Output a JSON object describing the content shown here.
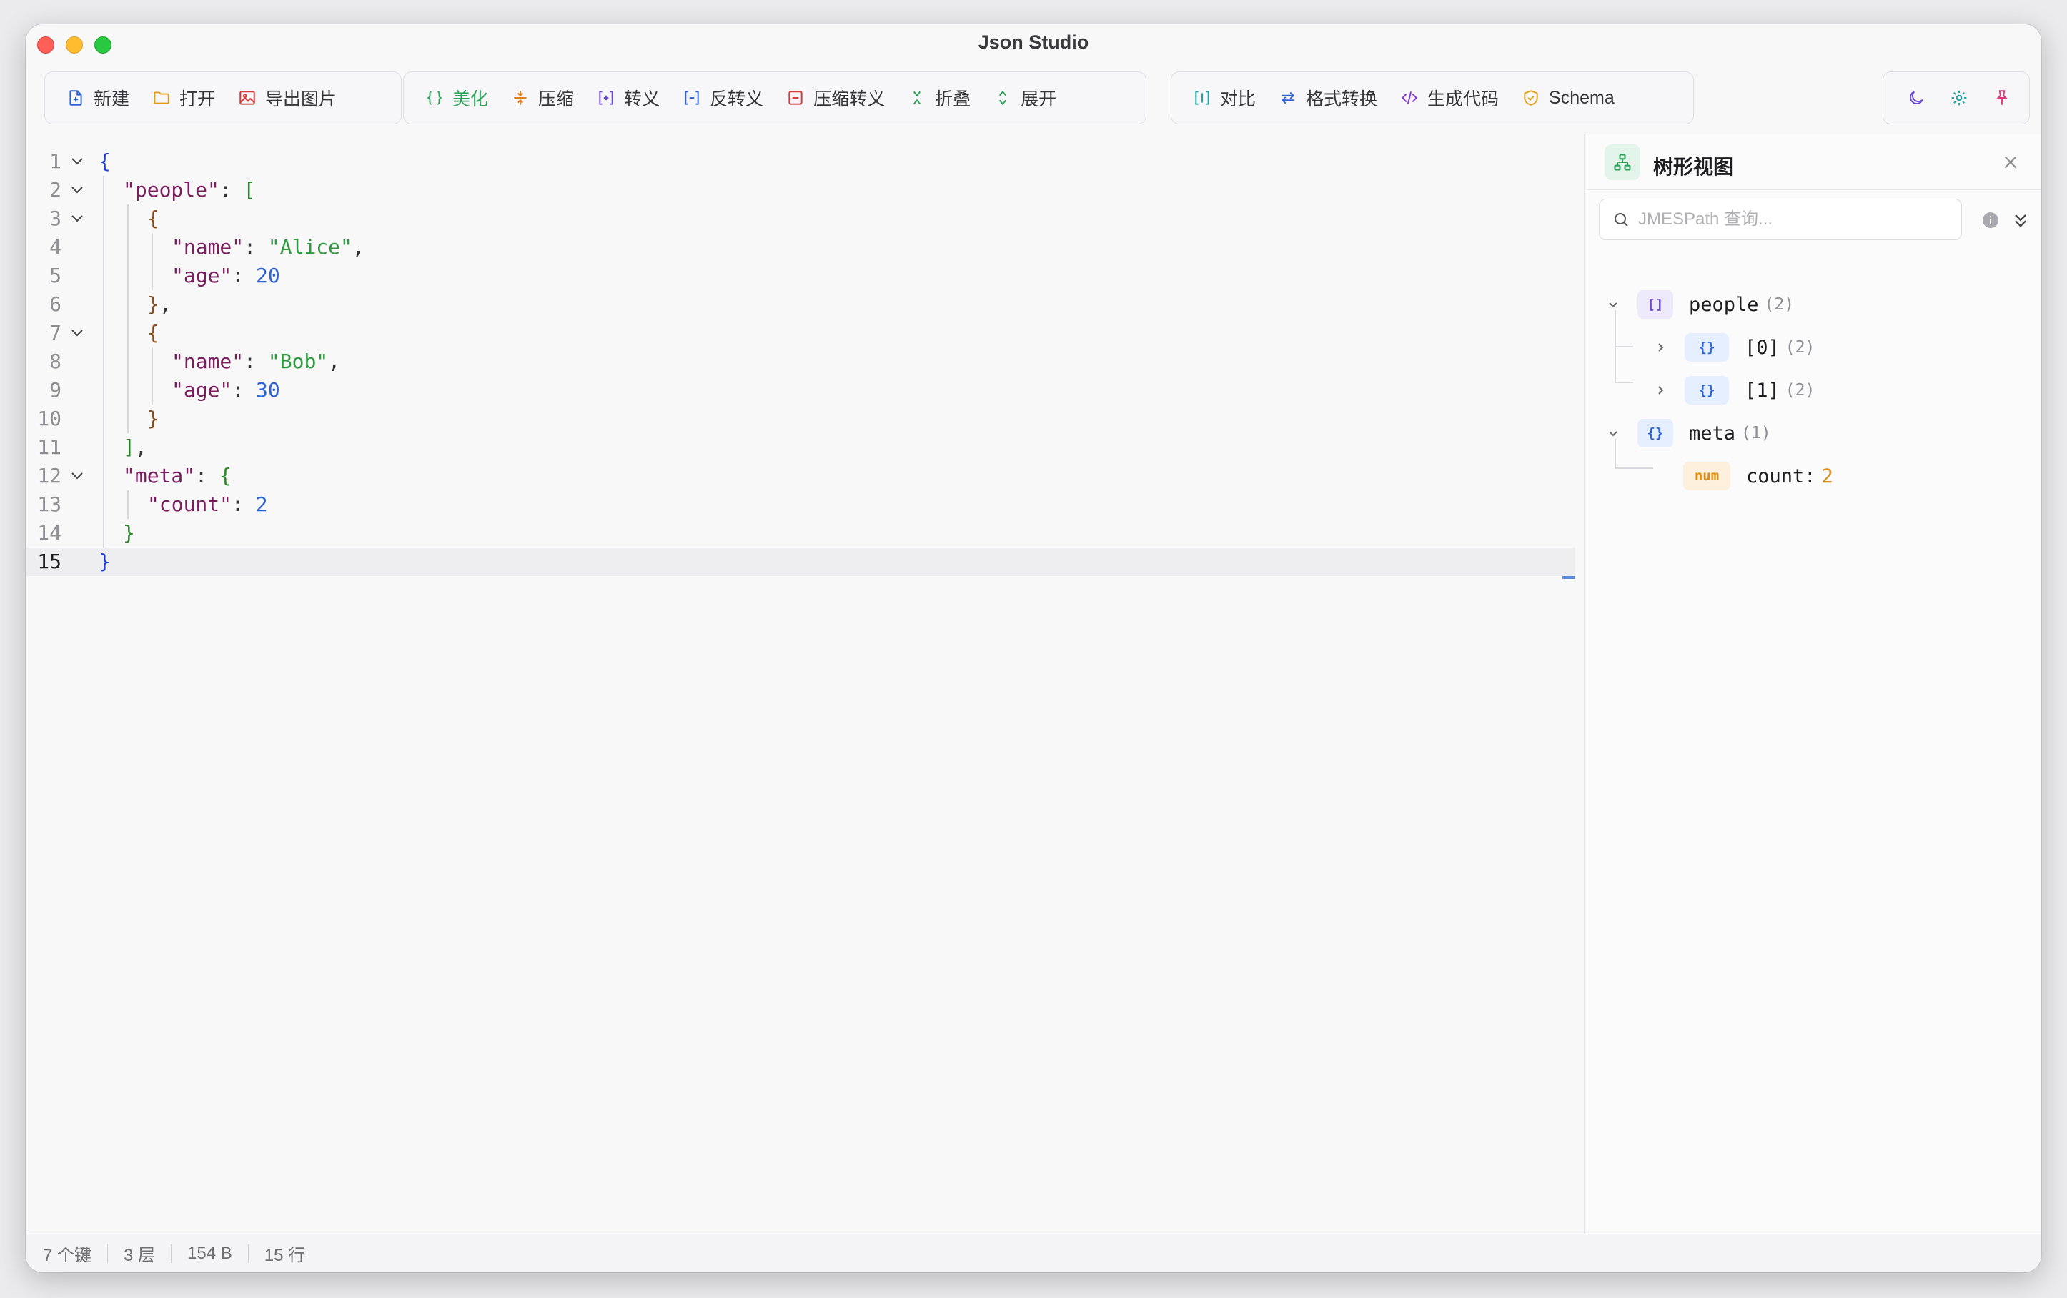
{
  "window": {
    "title": "Json Studio"
  },
  "toolbar": {
    "file_group": [
      {
        "name": "new-button",
        "icon": "new-file-icon",
        "label": "新建"
      },
      {
        "name": "open-button",
        "icon": "folder-icon",
        "label": "打开"
      },
      {
        "name": "export-image-button",
        "icon": "image-icon",
        "label": "导出图片"
      }
    ],
    "format_group": [
      {
        "name": "beautify-button",
        "icon": "braces-icon",
        "label": "美化"
      },
      {
        "name": "compress-button",
        "icon": "compress-icon",
        "label": "压缩"
      },
      {
        "name": "escape-button",
        "icon": "escape-icon",
        "label": "转义"
      },
      {
        "name": "unescape-button",
        "icon": "unescape-icon",
        "label": "反转义"
      },
      {
        "name": "compress-escape-button",
        "icon": "minus-box-icon",
        "label": "压缩转义"
      },
      {
        "name": "collapse-button",
        "icon": "collapse-icon",
        "label": "折叠"
      },
      {
        "name": "expand-button",
        "icon": "expand-icon",
        "label": "展开"
      }
    ],
    "tools_group": [
      {
        "name": "compare-button",
        "icon": "compare-icon",
        "label": "对比"
      },
      {
        "name": "format-convert-button",
        "icon": "arrows-icon",
        "label": "格式转换"
      },
      {
        "name": "generate-code-button",
        "icon": "code-icon",
        "label": "生成代码"
      },
      {
        "name": "schema-button",
        "icon": "shield-icon",
        "label": "Schema"
      }
    ],
    "right_icons": [
      {
        "name": "dark-mode-icon"
      },
      {
        "name": "settings-gear-icon"
      },
      {
        "name": "pin-icon"
      }
    ]
  },
  "editor": {
    "current_line": 15,
    "lines": [
      {
        "num": "1",
        "fold": true,
        "indent": 0,
        "tokens": [
          [
            "b0",
            "{"
          ]
        ]
      },
      {
        "num": "2",
        "fold": true,
        "indent": 1,
        "tokens": [
          [
            "k",
            "\"people\""
          ],
          [
            "p",
            ": "
          ],
          [
            "b1",
            "["
          ]
        ]
      },
      {
        "num": "3",
        "fold": true,
        "indent": 2,
        "tokens": [
          [
            "b2",
            "{"
          ]
        ]
      },
      {
        "num": "4",
        "fold": false,
        "indent": 3,
        "tokens": [
          [
            "k",
            "\"name\""
          ],
          [
            "p",
            ": "
          ],
          [
            "s",
            "\"Alice\""
          ],
          [
            "p",
            ","
          ]
        ]
      },
      {
        "num": "5",
        "fold": false,
        "indent": 3,
        "tokens": [
          [
            "k",
            "\"age\""
          ],
          [
            "p",
            ": "
          ],
          [
            "n",
            "20"
          ]
        ]
      },
      {
        "num": "6",
        "fold": false,
        "indent": 2,
        "tokens": [
          [
            "b2",
            "}"
          ],
          [
            "p",
            ","
          ]
        ]
      },
      {
        "num": "7",
        "fold": true,
        "indent": 2,
        "tokens": [
          [
            "b2",
            "{"
          ]
        ]
      },
      {
        "num": "8",
        "fold": false,
        "indent": 3,
        "tokens": [
          [
            "k",
            "\"name\""
          ],
          [
            "p",
            ": "
          ],
          [
            "s",
            "\"Bob\""
          ],
          [
            "p",
            ","
          ]
        ]
      },
      {
        "num": "9",
        "fold": false,
        "indent": 3,
        "tokens": [
          [
            "k",
            "\"age\""
          ],
          [
            "p",
            ": "
          ],
          [
            "n",
            "30"
          ]
        ]
      },
      {
        "num": "10",
        "fold": false,
        "indent": 2,
        "tokens": [
          [
            "b2",
            "}"
          ]
        ]
      },
      {
        "num": "11",
        "fold": false,
        "indent": 1,
        "tokens": [
          [
            "b1",
            "]"
          ],
          [
            "p",
            ","
          ]
        ]
      },
      {
        "num": "12",
        "fold": true,
        "indent": 1,
        "tokens": [
          [
            "k",
            "\"meta\""
          ],
          [
            "p",
            ": "
          ],
          [
            "b1",
            "{"
          ]
        ]
      },
      {
        "num": "13",
        "fold": false,
        "indent": 2,
        "tokens": [
          [
            "k",
            "\"count\""
          ],
          [
            "p",
            ": "
          ],
          [
            "n",
            "2"
          ]
        ]
      },
      {
        "num": "14",
        "fold": false,
        "indent": 1,
        "tokens": [
          [
            "b1",
            "}"
          ]
        ]
      },
      {
        "num": "15",
        "fold": false,
        "indent": 0,
        "tokens": [
          [
            "b0",
            "}"
          ]
        ]
      }
    ]
  },
  "tree_panel": {
    "title": "树形视图",
    "search_placeholder": "JMESPath 查询...",
    "nodes": {
      "people": {
        "badge": "[]",
        "key": "people",
        "count": "(2)"
      },
      "item0": {
        "badge": "{}",
        "key": "[0]",
        "count": "(2)"
      },
      "item1": {
        "badge": "{}",
        "key": "[1]",
        "count": "(2)"
      },
      "meta": {
        "badge": "{}",
        "key": "meta",
        "count": "(1)"
      },
      "count": {
        "badge": "num",
        "key": "count:",
        "value": "2"
      }
    }
  },
  "status": {
    "keys": "7 个键",
    "depth": "3 层",
    "size": "154 B",
    "lines": "15 行"
  },
  "colors": {
    "accent_green": "#2fa35a",
    "accent_blue": "#2f64d6",
    "accent_purple": "#6b4bd6",
    "accent_orange": "#e08a10",
    "accent_red": "#d83a3a"
  }
}
